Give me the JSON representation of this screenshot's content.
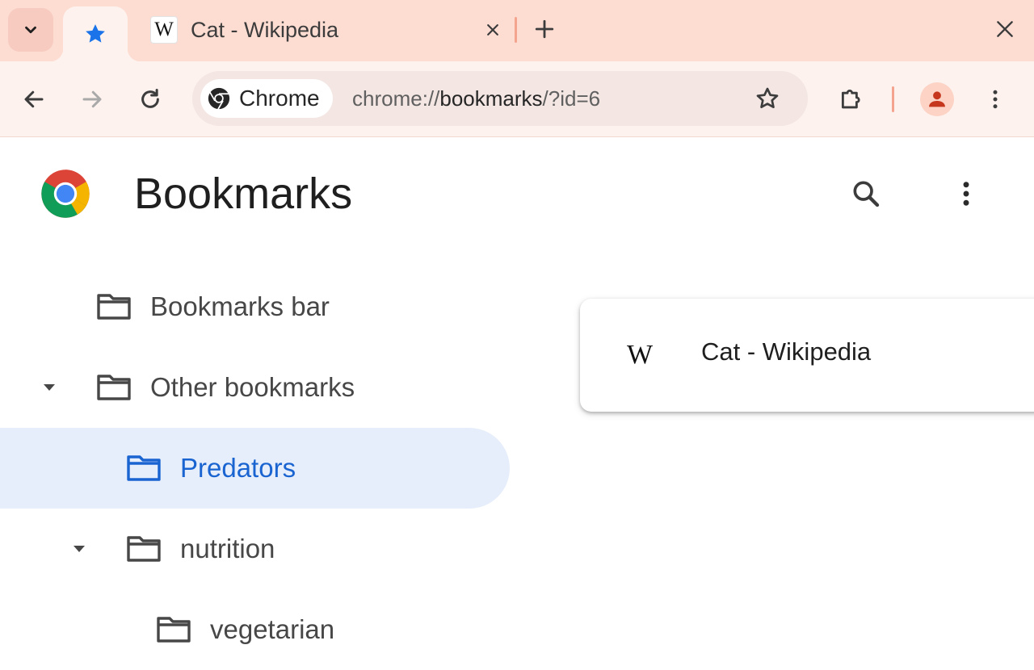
{
  "tabs": {
    "search_tabs_icon": "chevron-down-icon",
    "active_tab_icon": "star-icon",
    "second_tab": {
      "favicon_text": "W",
      "title": "Cat - Wikipedia"
    },
    "new_tab_icon": "plus-icon",
    "window_close_icon": "close-icon"
  },
  "toolbar": {
    "back_icon": "arrow-left-icon",
    "forward_icon": "arrow-right-icon",
    "reload_icon": "reload-icon",
    "omnibox": {
      "chip_label": "Chrome",
      "url_scheme": "chrome://",
      "url_host": "bookmarks",
      "url_path": "/?id=6"
    },
    "bookmark_star_icon": "star-outline-icon",
    "extensions_icon": "puzzle-icon",
    "menu_icon": "more-vert-icon"
  },
  "page": {
    "title": "Bookmarks",
    "search_icon": "search-icon",
    "more_icon": "more-vert-icon"
  },
  "tree": [
    {
      "label": "Bookmarks bar",
      "depth": 1,
      "expanded": false,
      "selected": false
    },
    {
      "label": "Other bookmarks",
      "depth": 1,
      "expanded": true,
      "selected": false
    },
    {
      "label": "Predators",
      "depth": 2,
      "expanded": false,
      "selected": true
    },
    {
      "label": "nutrition",
      "depth": 2,
      "expanded": true,
      "selected": false
    },
    {
      "label": "vegetarian",
      "depth": 3,
      "expanded": false,
      "selected": false
    }
  ],
  "bookmarks": [
    {
      "favicon_text": "W",
      "title": "Cat - Wikipedia"
    }
  ],
  "colors": {
    "tabstrip_bg": "#fddcd2",
    "toolbar_bg": "#fdf2ee",
    "accent_blue": "#1a64d1",
    "selected_row_bg": "#e6eefb",
    "profile_red": "#c5361d"
  }
}
